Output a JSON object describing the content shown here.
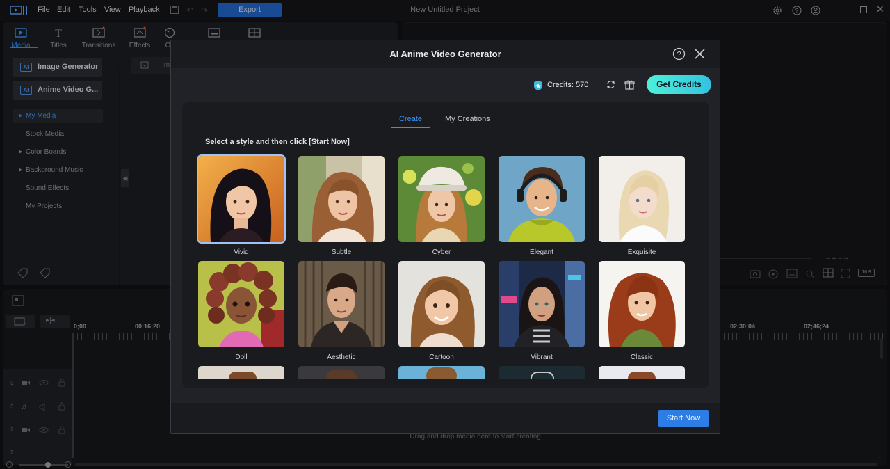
{
  "menubar": {
    "items": [
      "File",
      "Edit",
      "Tools",
      "View",
      "Playback"
    ],
    "export_label": "Export",
    "project_title": "New Untitled Project"
  },
  "library": {
    "tabs": [
      {
        "label": "Media",
        "icon": "media-icon"
      },
      {
        "label": "Titles",
        "icon": "titles-icon"
      },
      {
        "label": "Transitions",
        "icon": "transitions-icon"
      },
      {
        "label": "Effects",
        "icon": "effects-icon"
      },
      {
        "label": "Ov",
        "icon": "overlay-icon"
      }
    ],
    "ai_buttons": [
      "Image Generator",
      "Anime Video G..."
    ],
    "tree": [
      "My Media",
      "Stock Media",
      "Color Boards",
      "Background Music",
      "Sound Effects",
      "My Projects"
    ],
    "search_stub": "Im"
  },
  "preview": {
    "timecode": "--:--:--:--",
    "ratio": "16:9"
  },
  "timeline": {
    "ruler": [
      "0;00",
      "00;16;20",
      "02;30;04",
      "02;46;24"
    ],
    "tracks": [
      "3",
      "3",
      "2",
      "2"
    ],
    "drag_hint": "Drag and drop media here to start creating."
  },
  "dialog": {
    "title": "AI Anime Video Generator",
    "credits_label": "Credits: 570",
    "get_credits_label": "Get Credits",
    "tabs": [
      "Create",
      "My Creations"
    ],
    "instruction": "Select a style and then click [Start Now]",
    "styles": [
      "Vivid",
      "Subtle",
      "Cyber",
      "Elegant",
      "Exquisite",
      "Doll",
      "Aesthetic",
      "Cartoon",
      "Vibrant",
      "Classic"
    ],
    "selected_style": "Vivid",
    "start_label": "Start Now"
  },
  "colors": {
    "accent": "#3a8ef0",
    "get_credits_gradient": [
      "#4ef0d9",
      "#33c2e0"
    ],
    "start_button": "#2d7de6"
  }
}
